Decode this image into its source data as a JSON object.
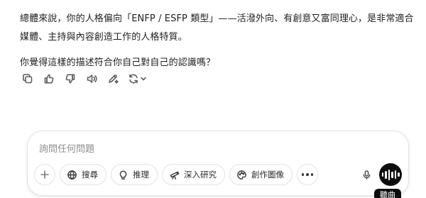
{
  "message": {
    "paragraph_1": "總體來說，你的人格偏向「ENFP / ESFP 類型」——活潑外向、有創意又富同理心，是非常適合媒體、主持與內容創造工作的人格特質。",
    "paragraph_2": "你覺得這樣的描述符合你自己對自己的認識嗎？"
  },
  "message_actions": [
    {
      "name": "copy-icon"
    },
    {
      "name": "thumbs-up-icon"
    },
    {
      "name": "thumbs-down-icon"
    },
    {
      "name": "read-aloud-icon"
    },
    {
      "name": "edit-in-canvas-icon"
    },
    {
      "name": "regenerate-icon"
    }
  ],
  "composer": {
    "placeholder": "詢問任何問題",
    "value": "",
    "tools": {
      "search_label": "搜尋",
      "reason_label": "推理",
      "deep_research_label": "深入研究",
      "create_image_label": "創作圖像"
    },
    "voice_tooltip": "聽曲"
  },
  "colors": {
    "text": "#1f1f1f",
    "muted_icon": "#5d5d5d",
    "border": "#e3e3e3",
    "voice_button": "#0d0d0d",
    "placeholder": "#8e8e8e"
  }
}
